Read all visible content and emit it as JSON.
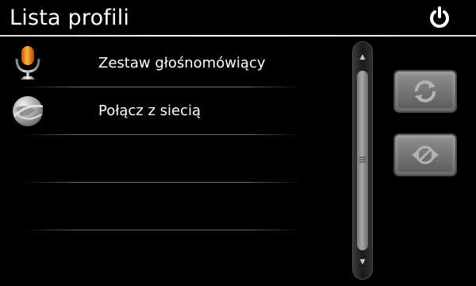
{
  "header": {
    "title": "Lista profili",
    "power_icon": "power-icon"
  },
  "profiles": [
    {
      "label": "Zestaw głośnomówiący",
      "icon": "microphone-icon"
    },
    {
      "label": "Połącz z siecią",
      "icon": "network-globe-icon"
    }
  ],
  "empty_rows": 3,
  "sidebar": {
    "refresh_icon": "refresh-icon",
    "disconnect_icon": "disconnect-icon"
  },
  "colors": {
    "background": "#000000",
    "text": "#ffffff",
    "button": "#808080"
  }
}
